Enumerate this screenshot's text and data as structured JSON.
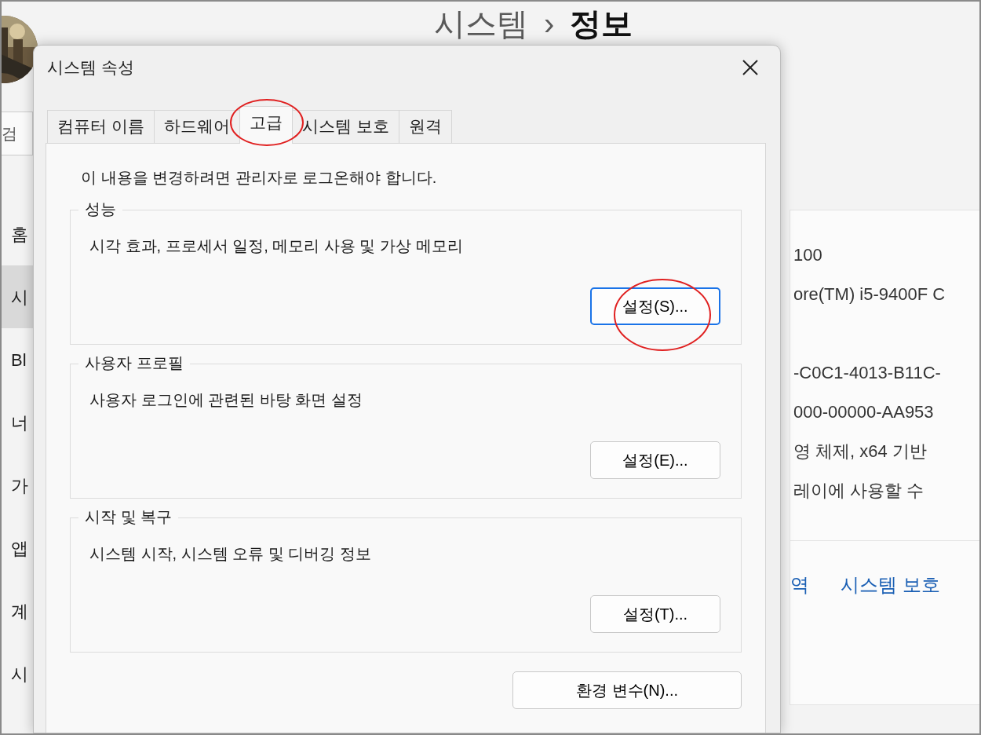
{
  "background_window": {
    "breadcrumb": {
      "parent": "시스템",
      "separator": "›",
      "current": "정보"
    },
    "search": {
      "placeholder": "검"
    },
    "sidebar": {
      "items": [
        {
          "label": "홈",
          "selected": false
        },
        {
          "label": "시",
          "selected": true
        },
        {
          "label": "Bl",
          "selected": false
        },
        {
          "label": "너",
          "selected": false
        },
        {
          "label": "가",
          "selected": false
        },
        {
          "label": "앱",
          "selected": false
        },
        {
          "label": "계",
          "selected": false
        },
        {
          "label": "시",
          "selected": false
        }
      ]
    },
    "info_sections": [
      [
        "100",
        "ore(TM) i5-9400F C"
      ],
      [
        "-C0C1-4013-B11C-",
        "000-00000-AA953",
        "영 체제, x64 기반",
        "레이에 사용할 수"
      ]
    ],
    "links": [
      "역",
      "시스템 보호"
    ]
  },
  "dialog": {
    "title": "시스템 속성",
    "tabs": [
      {
        "label": "컴퓨터 이름",
        "selected": false,
        "annotated": false
      },
      {
        "label": "하드웨어",
        "selected": false,
        "annotated": false
      },
      {
        "label": "고급",
        "selected": true,
        "annotated": true
      },
      {
        "label": "시스템 보호",
        "selected": false,
        "annotated": false
      },
      {
        "label": "원격",
        "selected": false,
        "annotated": false
      }
    ],
    "notice": "이 내용을 변경하려면 관리자로 로그온해야 합니다.",
    "groups": [
      {
        "title": "성능",
        "description": "시각 효과, 프로세서 일정, 메모리 사용 및 가상 메모리",
        "button": {
          "label": "설정(S)...",
          "focused": true,
          "annotated": true
        }
      },
      {
        "title": "사용자 프로필",
        "description": "사용자 로그인에 관련된 바탕 화면 설정",
        "button": {
          "label": "설정(E)...",
          "focused": false,
          "annotated": false
        }
      },
      {
        "title": "시작 및 복구",
        "description": "시스템 시작, 시스템 오류 및 디버깅 정보",
        "button": {
          "label": "설정(T)...",
          "focused": false,
          "annotated": false
        }
      }
    ],
    "env_button": {
      "label": "환경 변수(N)..."
    }
  }
}
